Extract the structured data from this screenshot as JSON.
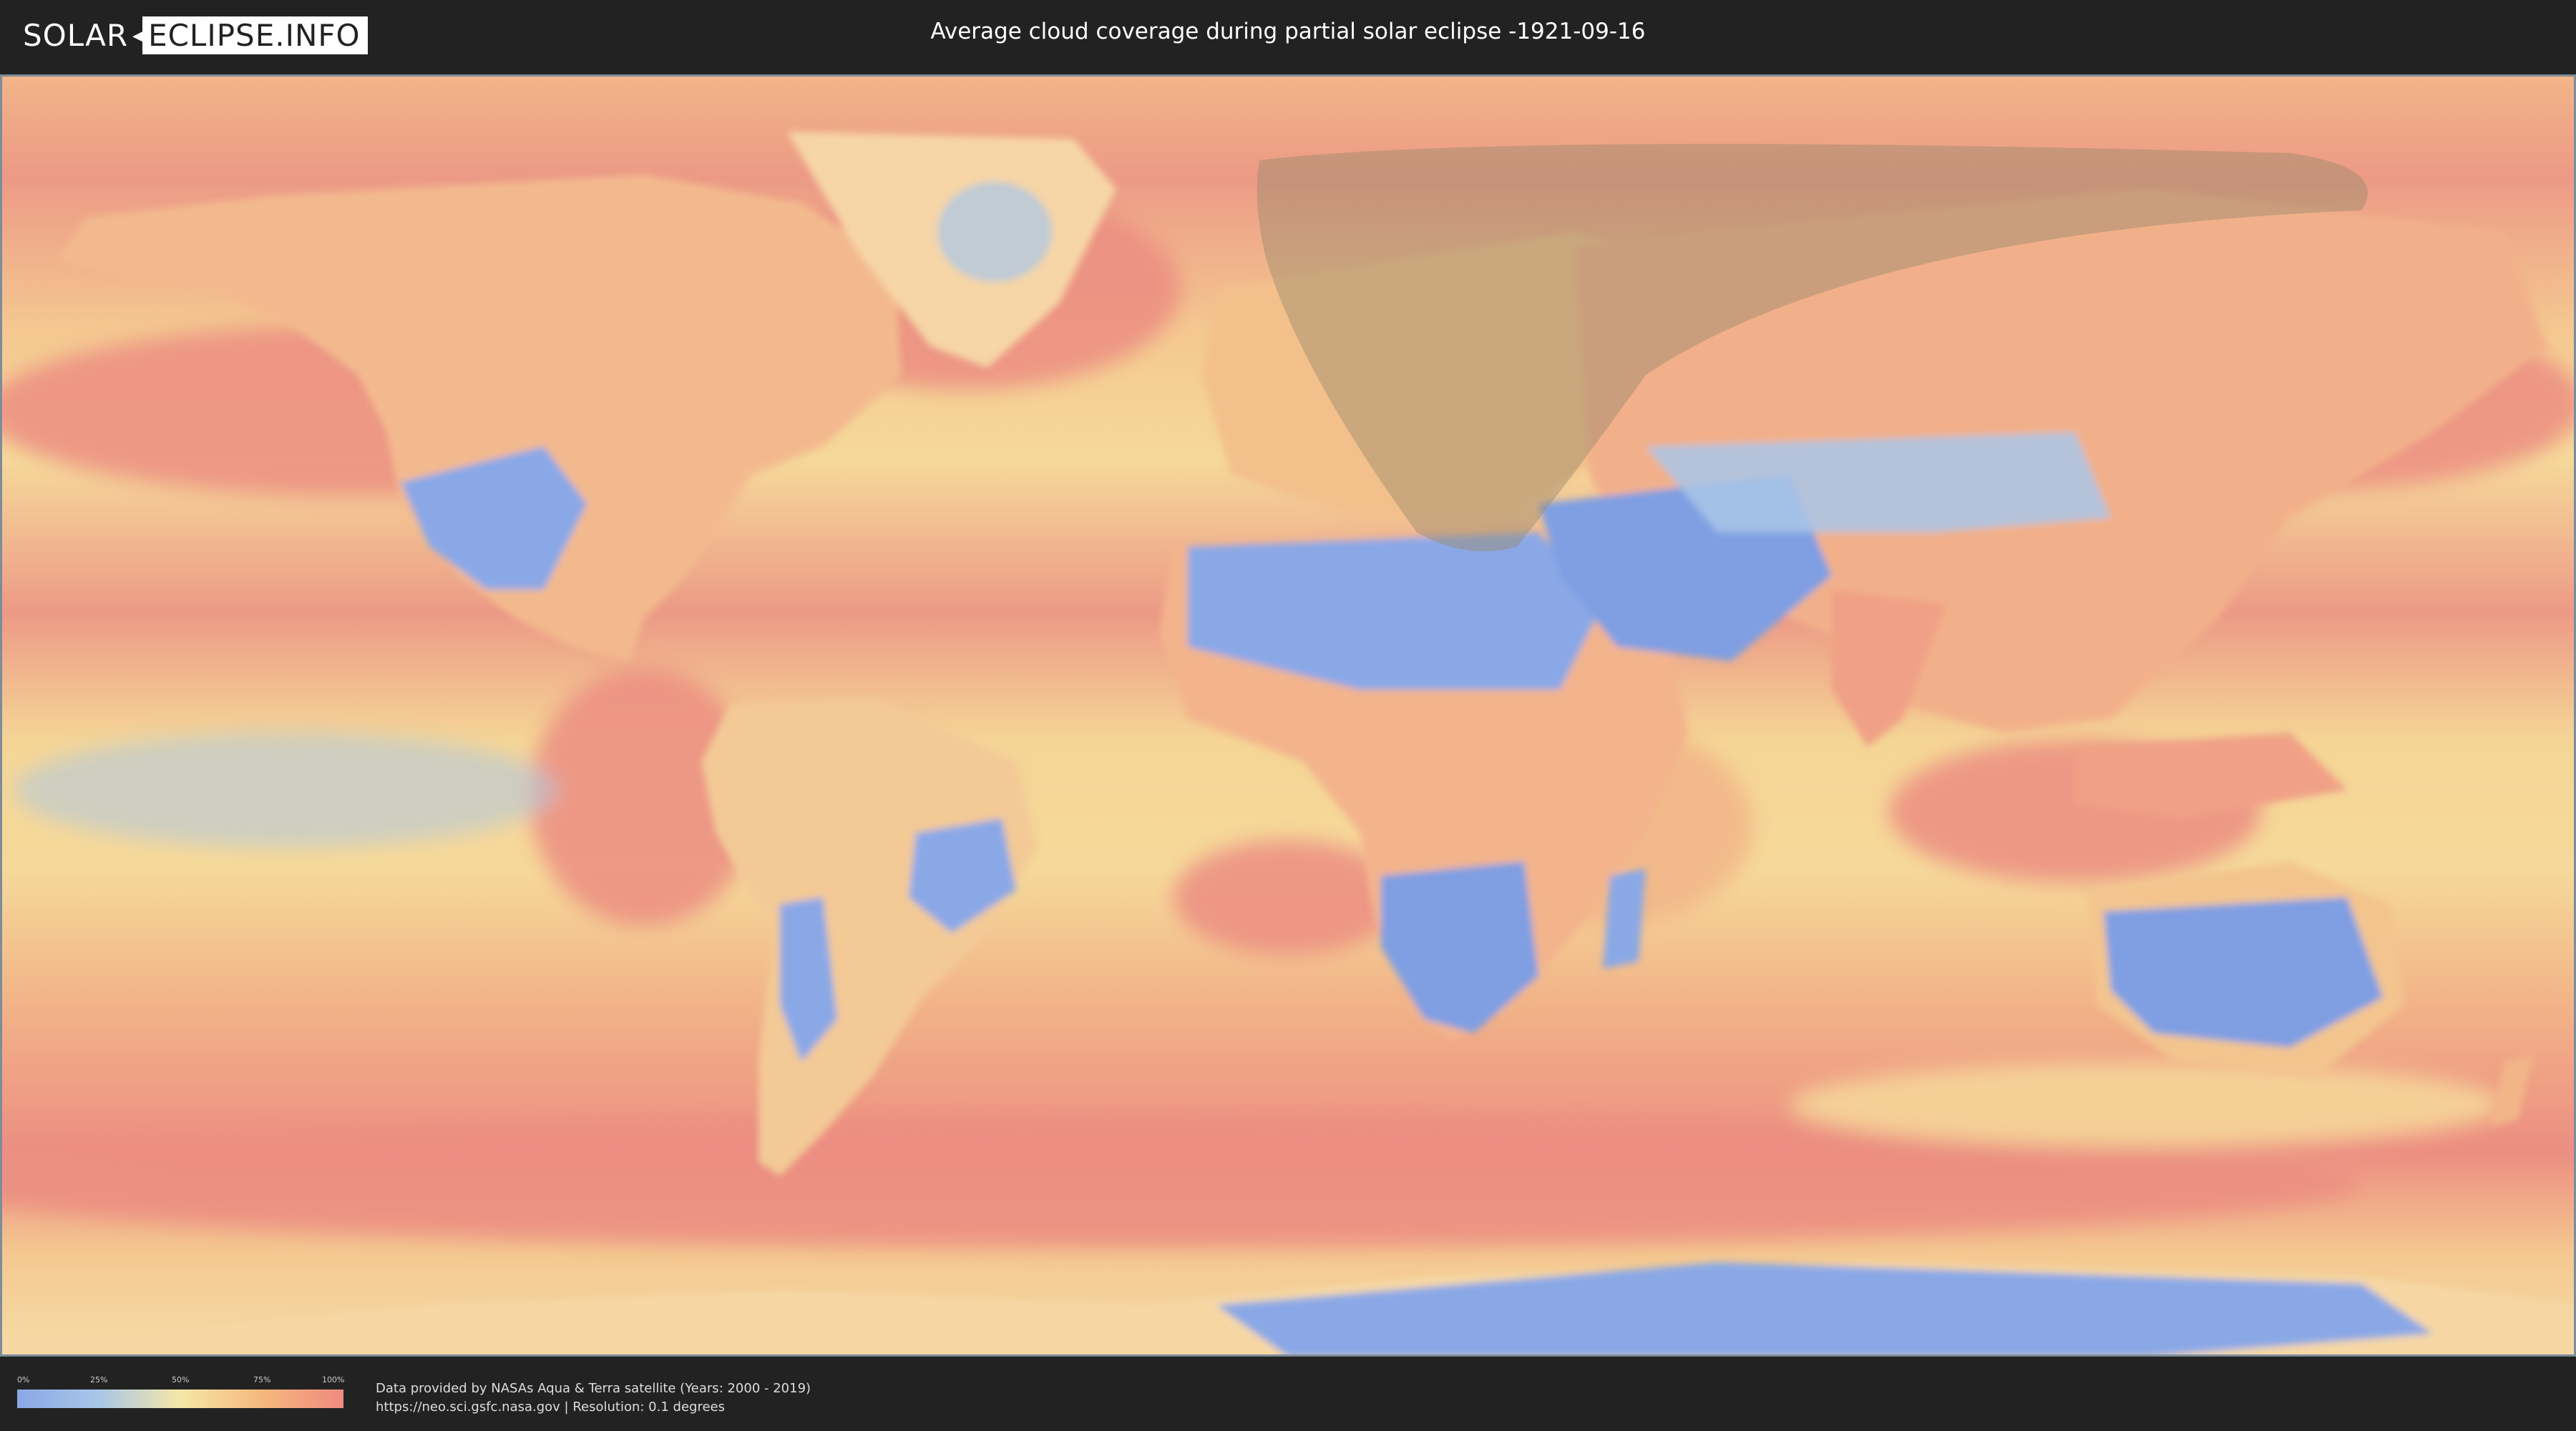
{
  "header": {
    "logo_part1": "SOLAR",
    "logo_part2": "ECLIPSE.INFO",
    "title": "Average cloud coverage during partial solar eclipse -1921-09-16"
  },
  "legend": {
    "ticks": [
      "0%",
      "25%",
      "50%",
      "75%",
      "100%"
    ],
    "colors": [
      "#8aa8e6",
      "#a9c6e8",
      "#f5e7a8",
      "#f5b87c",
      "#ef8a80"
    ]
  },
  "footer": {
    "credit_line1": "Data provided by NASAs Aqua & Terra satellite (Years: 2000 - 2019)",
    "credit_line2": "https://neo.sci.gsfc.nasa.gov | Resolution: 0.1 degrees"
  },
  "map": {
    "projection": "equirectangular",
    "eclipse_region_color": "#9a8a6a",
    "land_clear_color": "#8aa8e6",
    "ocean_cloudy_color": "#ef8a80",
    "mid_color": "#f5e7a8"
  }
}
